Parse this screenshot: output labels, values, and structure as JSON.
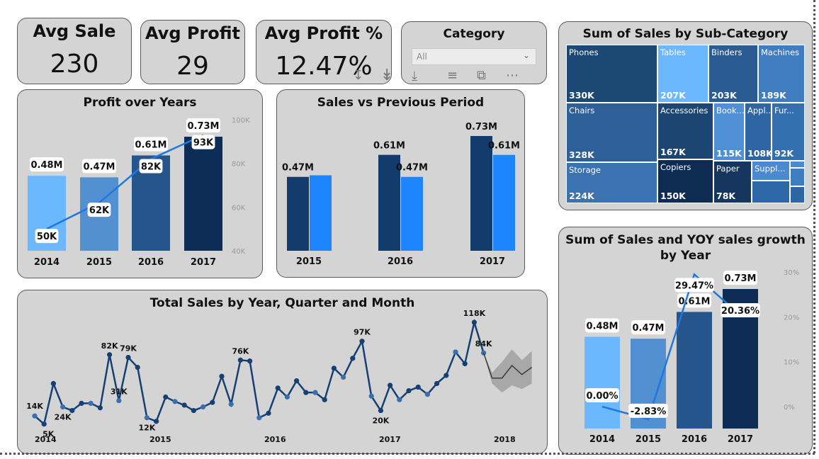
{
  "kpis": [
    {
      "title": "Avg Sale",
      "value": "230"
    },
    {
      "title": "Avg Profit",
      "value": "29"
    },
    {
      "title": "Avg Profit %",
      "value": "12.47%"
    }
  ],
  "slicer": {
    "title": "Category",
    "value": "All"
  },
  "visual_header_icons": [
    "sort-down-icon",
    "double-down-arrow-icon",
    "drill-down-icon",
    "filter-icon",
    "focus-mode-icon",
    "more-options-icon"
  ],
  "colors": {
    "light": "#6cb8ff",
    "mid": "#5290d2",
    "dark": "#25558a",
    "darkest": "#0d2d56",
    "bright": "#1f85ff",
    "line": "#1e78e0",
    "trend": "#163f73"
  },
  "chart_data": [
    {
      "type": "bar",
      "title": "Profit over Years",
      "categories": [
        "2014",
        "2015",
        "2016",
        "2017"
      ],
      "series": [
        {
          "values": [
            0.48,
            0.47,
            0.61,
            0.73
          ],
          "labels": [
            "0.48M",
            "0.47M",
            "0.61M",
            "0.73M"
          ]
        },
        {
          "values": [
            50,
            62,
            82,
            93
          ],
          "labels": [
            "50K",
            "62K",
            "82K",
            "93K"
          ]
        }
      ],
      "y2_ticks": [
        "100K",
        "80K",
        "60K",
        "40K"
      ],
      "y2lim": [
        40,
        100
      ]
    },
    {
      "type": "bar",
      "title": "Sales vs Previous Period",
      "categories": [
        "2015",
        "2016",
        "2017"
      ],
      "series": [
        {
          "values": [
            0.47,
            0.61,
            0.73
          ],
          "labels": [
            "0.47M",
            "0.61M",
            "0.73M"
          ]
        },
        {
          "values": [
            0.48,
            0.47,
            0.61
          ],
          "labels": [
            "",
            "0.47M",
            "0.61M"
          ]
        }
      ]
    },
    {
      "type": "treemap",
      "title": "Sum of Sales by Sub-Category",
      "items": [
        {
          "name": "Phones",
          "value": "330K"
        },
        {
          "name": "Tables",
          "value": "207K"
        },
        {
          "name": "Binders",
          "value": "203K"
        },
        {
          "name": "Machines",
          "value": "189K"
        },
        {
          "name": "Chairs",
          "value": "328K"
        },
        {
          "name": "Accessories",
          "value": "167K"
        },
        {
          "name": "Book...",
          "value": "115K"
        },
        {
          "name": "Appl...",
          "value": "108K"
        },
        {
          "name": "Fur...",
          "value": "92K"
        },
        {
          "name": "Storage",
          "value": "224K"
        },
        {
          "name": "Copiers",
          "value": "150K"
        },
        {
          "name": "Paper",
          "value": "78K"
        },
        {
          "name": "Suppl...",
          "value": ""
        }
      ]
    },
    {
      "type": "line",
      "title": "Total Sales by Year, Quarter and Month",
      "x_ticks": [
        "2014",
        "2015",
        "2016",
        "2017",
        "2018"
      ],
      "values": [
        14,
        5,
        50,
        24,
        20,
        28,
        28,
        23,
        82,
        31,
        79,
        68,
        12,
        8,
        35,
        30,
        26,
        20,
        24,
        29,
        58,
        27,
        76,
        75,
        12,
        17,
        45,
        35,
        53,
        40,
        40,
        32,
        67,
        57,
        78,
        97,
        36,
        20,
        48,
        32,
        42,
        46,
        38,
        50,
        59,
        85,
        72,
        118,
        84
      ],
      "point_labels": {
        "0": "14K",
        "1": "5K",
        "3": "24K",
        "8": "82K",
        "9": "31K",
        "10": "79K",
        "12": "12K",
        "22": "76K",
        "35": "97K",
        "37": "20K",
        "47": "118K",
        "48": "84K"
      },
      "forecast": [
        56,
        56,
        70,
        60,
        68
      ],
      "forecast_low": [
        50,
        40,
        48,
        44,
        50
      ],
      "forecast_high": [
        62,
        74,
        88,
        76,
        86
      ]
    },
    {
      "type": "bar",
      "title": "Sum of Sales and YOY sales growth by Year",
      "categories": [
        "2014",
        "2015",
        "2016",
        "2017"
      ],
      "series": [
        {
          "values": [
            0.48,
            0.47,
            0.61,
            0.73
          ],
          "labels": [
            "0.48M",
            "0.47M",
            "0.61M",
            "0.73M"
          ]
        },
        {
          "values": [
            0.0,
            -2.83,
            29.47,
            20.36
          ],
          "labels": [
            "0.00%",
            "-2.83%",
            "29.47%",
            "20.36%"
          ]
        }
      ],
      "y2_ticks": [
        "30%",
        "20%",
        "10%",
        "0%"
      ],
      "y2lim": [
        -5,
        30
      ]
    }
  ]
}
